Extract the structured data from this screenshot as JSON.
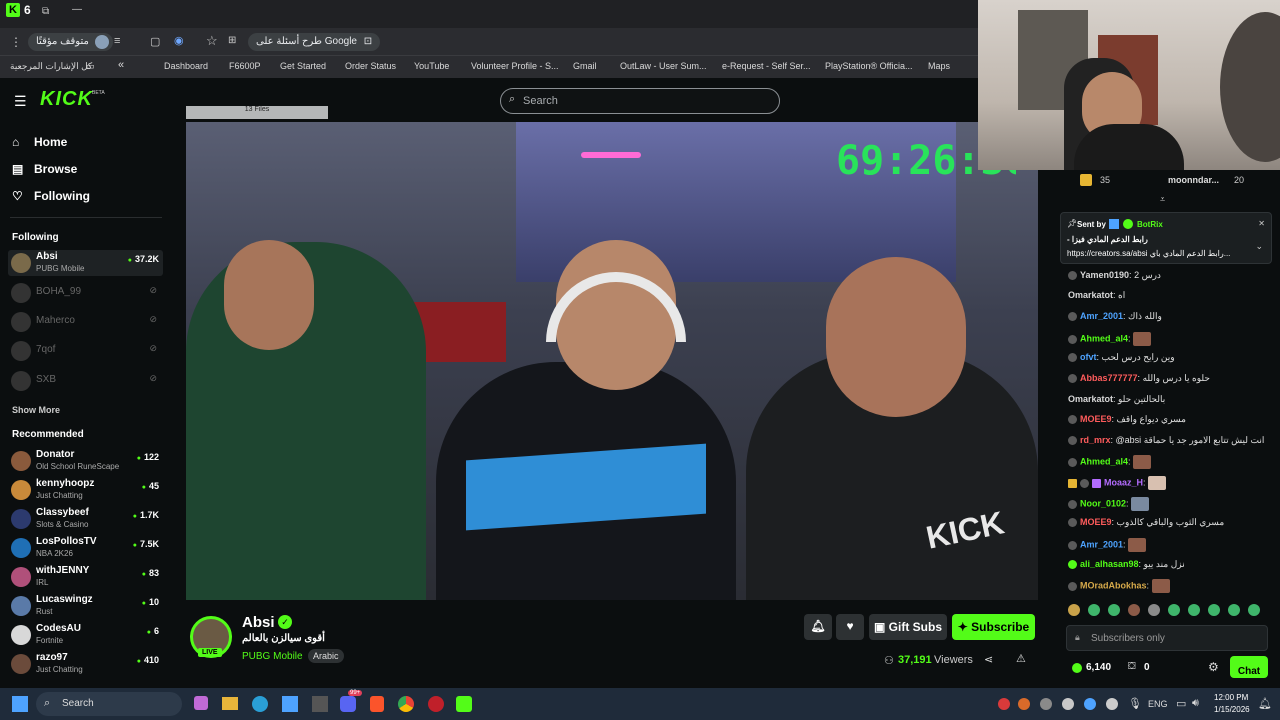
{
  "browser": {
    "tab_count": "6",
    "status_label": "متوقف مؤقتًا",
    "google_ask": "طرح أسئلة على Google",
    "all_bookmarks": "كل الإشارات المرجعية",
    "bookmarks": [
      "Dashboard",
      "F6600P",
      "Get Started",
      "Order Status",
      "YouTube",
      "Volunteer Profile - S...",
      "Gmail",
      "OutLaw - User Sum...",
      "e-Request - Self Ser...",
      "PlayStation® Officia...",
      "Maps"
    ]
  },
  "kick": {
    "logo": "KICK",
    "beta": "BETA",
    "search_placeholder": "Search",
    "nav": [
      {
        "label": "Home",
        "icon": "home-icon"
      },
      {
        "label": "Browse",
        "icon": "browse-icon"
      },
      {
        "label": "Following",
        "icon": "heart-icon"
      }
    ],
    "following_title": "Following",
    "following": [
      {
        "name": "Absi",
        "game": "PUBG Mobile",
        "viewers": "37.2K",
        "live": true
      },
      {
        "name": "BOHA_99",
        "live": false
      },
      {
        "name": "Maherco",
        "live": false
      },
      {
        "name": "7qof",
        "live": false
      },
      {
        "name": "SXB",
        "live": false
      }
    ],
    "show_more": "Show More",
    "recommended_title": "Recommended",
    "recommended": [
      {
        "name": "Donator",
        "game": "Old School RuneScape",
        "viewers": "122",
        "color": "#8a5a3c"
      },
      {
        "name": "kennyhoopz",
        "game": "Just Chatting",
        "viewers": "45",
        "color": "#c98a3a"
      },
      {
        "name": "Classybeef",
        "game": "Slots & Casino",
        "viewers": "1.7K",
        "color": "#2c3a6e"
      },
      {
        "name": "LosPollosTV",
        "game": "NBA 2K26",
        "viewers": "7.5K",
        "color": "#1f6fb5"
      },
      {
        "name": "withJENNY",
        "game": "IRL",
        "viewers": "83",
        "color": "#b0507a"
      },
      {
        "name": "Lucaswingz",
        "game": "Rust",
        "viewers": "10",
        "color": "#5a7aa8"
      },
      {
        "name": "CodesAU",
        "game": "Fortnite",
        "viewers": "6",
        "color": "#d8d8d8"
      },
      {
        "name": "razo97",
        "game": "Just Chatting",
        "viewers": "410",
        "color": "#6b4b3b"
      }
    ],
    "stream_timer": "69:26:36",
    "files_label": "13 Files",
    "channel": {
      "name": "Absi",
      "title": "أقوى سيالزن بالعالم",
      "category": "PUBG Mobile",
      "language": "Arabic",
      "live_badge": "LIVE",
      "viewers": "37,191",
      "viewers_label": "Viewers",
      "gift_subs": "Gift Subs",
      "subscribe": "Subscribe"
    },
    "chat": {
      "leaders": [
        {
          "n": "35"
        },
        {
          "name": "moonndar...",
          "n": "20"
        }
      ],
      "pinned_sender_label": "Sent by",
      "pinned_sender": "BotRix",
      "pinned_text": "- رابط الدعم المادي فيزا",
      "pinned_link": "https://creators.sa/absi رابط الدعم المادي باي...",
      "messages": [
        {
          "user": "Yamen0190",
          "text": "درس 2",
          "color": "#d8d8d8"
        },
        {
          "user": "Omarkatot",
          "text": "اه",
          "color": "#d8d8d8"
        },
        {
          "user": "Amr_2001",
          "text": "والله ذاك",
          "color": "#4ea3ff"
        },
        {
          "user": "Ahmed_al4",
          "text": "",
          "emote": true,
          "color": "#53fc18"
        },
        {
          "user": "ofvt",
          "text": "وين رايح درس لحب",
          "color": "#4ea3ff"
        },
        {
          "user": "Abbas777777",
          "text": "حلوه يا درس والله",
          "color": "#ff5c5c"
        },
        {
          "user": "Omarkatot",
          "text": "بالحالتين حلو",
          "color": "#d8d8d8"
        },
        {
          "user": "MOEE9",
          "text": "مسري ديواع واقف",
          "color": "#ff5c5c"
        },
        {
          "user": "rd_mrx",
          "text": "@absi انت ليش تتابع الامور جد يا حماقة",
          "color": "#ff5c5c"
        },
        {
          "user": "Ahmed_al4",
          "text": "",
          "emote": true,
          "color": "#53fc18"
        },
        {
          "user": "Moaaz_H",
          "text": "",
          "emote": true,
          "color": "#b46cff"
        },
        {
          "user": "Noor_0102",
          "text": "",
          "emote": true,
          "color": "#53fc18"
        },
        {
          "user": "MOEE9",
          "text": "مسري الثوب والباقي كالذوب",
          "color": "#ff5c5c"
        },
        {
          "user": "Amr_2001",
          "text": "",
          "emote": true,
          "color": "#4ea3ff"
        },
        {
          "user": "ali_alhasan98",
          "text": "نزل مند ييو",
          "color": "#53fc18"
        },
        {
          "user": "MOradAbokhas",
          "text": "",
          "emote": true,
          "color": "#d6a94a"
        }
      ],
      "input_placeholder": "Subscribers only",
      "points": "6,140",
      "redeem": "0",
      "chat_button": "Chat"
    }
  },
  "taskbar": {
    "search": "Search",
    "lang": "ENG",
    "time": "12:00 PM",
    "date": "1/15/2026",
    "badge": "99+"
  },
  "colors": {
    "kick_green": "#53fc18",
    "bg": "#0b0e0f"
  }
}
